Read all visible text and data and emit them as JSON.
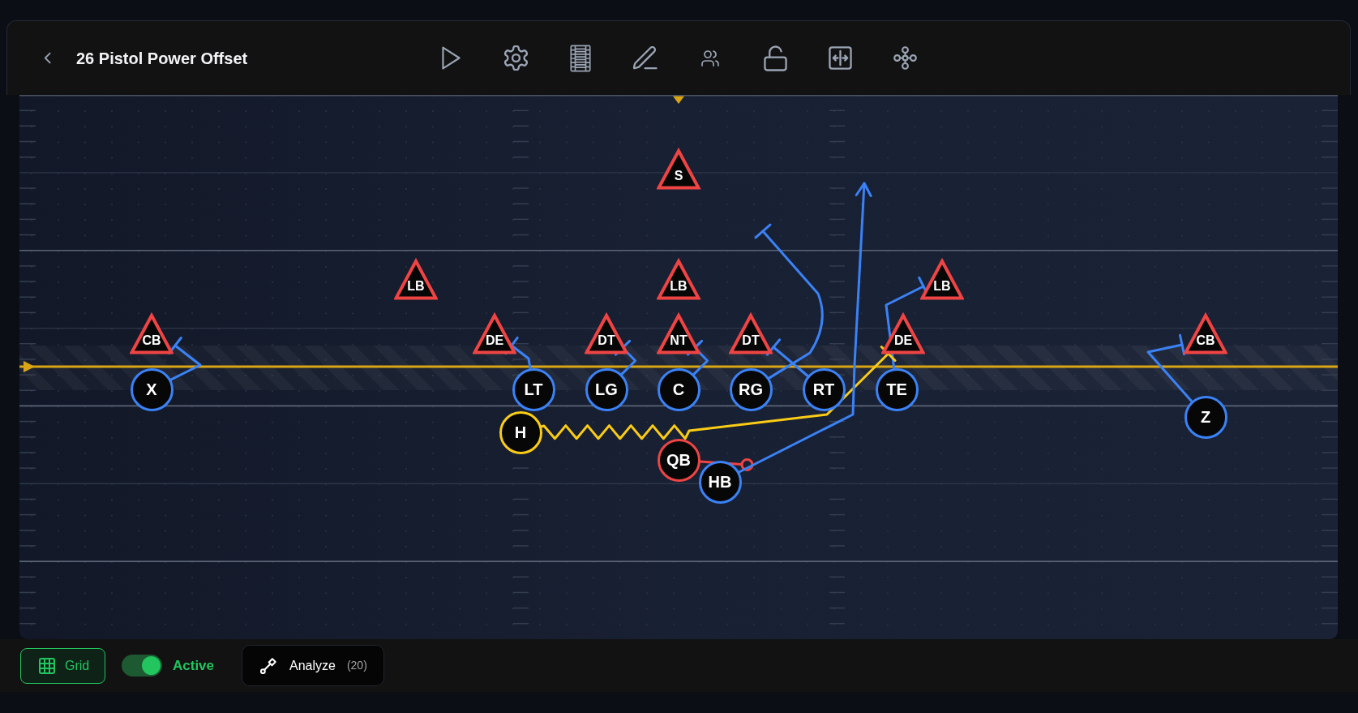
{
  "header": {
    "title": "26 Pistol Power Offset"
  },
  "field": {
    "players": [
      {
        "label": "S",
        "kind": "triangle",
        "color": "#ef4444"
      },
      {
        "label": "LB",
        "kind": "triangle",
        "color": "#ef4444"
      },
      {
        "label": "LB",
        "kind": "triangle",
        "color": "#ef4444"
      },
      {
        "label": "LB",
        "kind": "triangle",
        "color": "#ef4444"
      },
      {
        "label": "CB",
        "kind": "triangle",
        "color": "#ef4444"
      },
      {
        "label": "DE",
        "kind": "triangle",
        "color": "#ef4444"
      },
      {
        "label": "DT",
        "kind": "triangle",
        "color": "#ef4444"
      },
      {
        "label": "NT",
        "kind": "triangle",
        "color": "#ef4444"
      },
      {
        "label": "DT",
        "kind": "triangle",
        "color": "#ef4444"
      },
      {
        "label": "DE",
        "kind": "triangle",
        "color": "#ef4444"
      },
      {
        "label": "CB",
        "kind": "triangle",
        "color": "#ef4444"
      },
      {
        "label": "X",
        "kind": "circle",
        "color": "#3b82f6"
      },
      {
        "label": "LT",
        "kind": "circle",
        "color": "#3b82f6"
      },
      {
        "label": "LG",
        "kind": "circle",
        "color": "#3b82f6"
      },
      {
        "label": "C",
        "kind": "circle",
        "color": "#3b82f6"
      },
      {
        "label": "RG",
        "kind": "circle",
        "color": "#3b82f6"
      },
      {
        "label": "RT",
        "kind": "circle",
        "color": "#3b82f6"
      },
      {
        "label": "TE",
        "kind": "circle",
        "color": "#3b82f6"
      },
      {
        "label": "Z",
        "kind": "circle",
        "color": "#3b82f6"
      },
      {
        "label": "H",
        "kind": "circle",
        "color": "#facc15"
      },
      {
        "label": "QB",
        "kind": "circle",
        "color": "#ef4444"
      },
      {
        "label": "HB",
        "kind": "circle",
        "color": "#3b82f6"
      }
    ]
  },
  "bottom_bar": {
    "grid_button": {
      "label": "Grid",
      "selected": true
    },
    "active_toggle": {
      "label": "Active",
      "on": true
    },
    "analyze_button": {
      "label": "Analyze",
      "count": "(20)"
    }
  }
}
